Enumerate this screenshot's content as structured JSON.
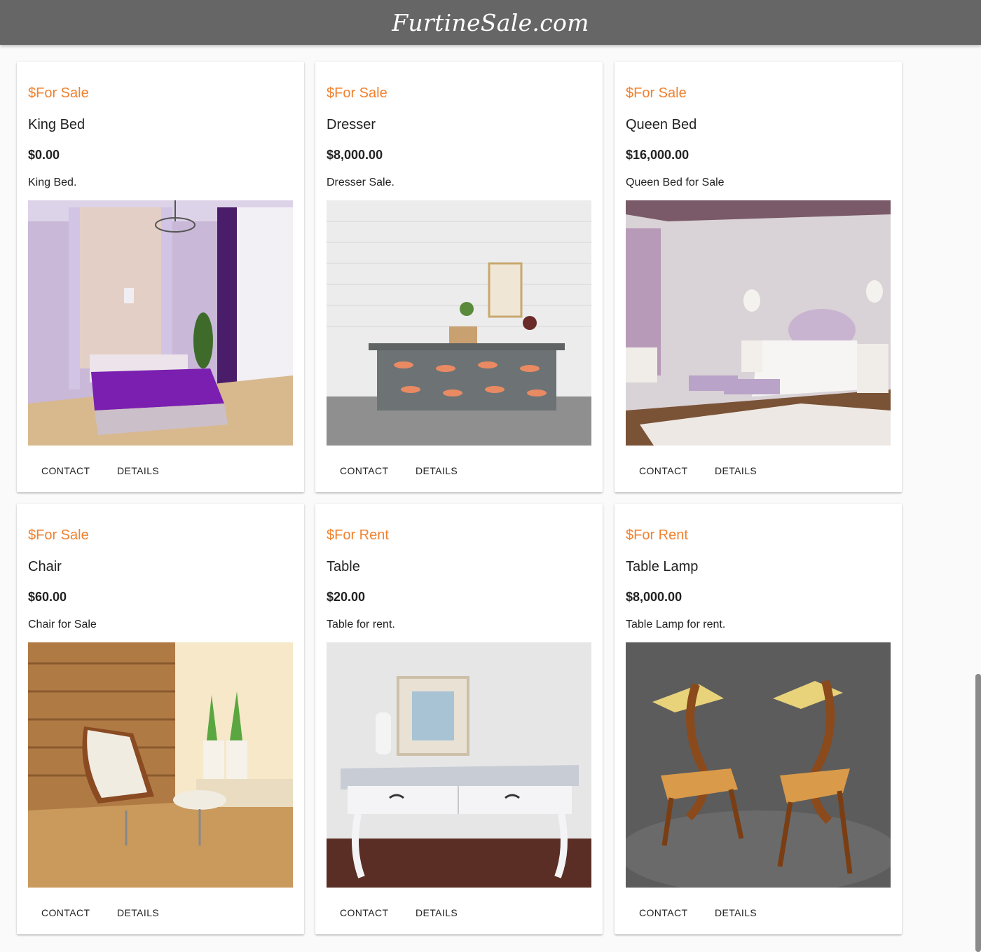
{
  "header": {
    "brand": "FurtineSale.com"
  },
  "cards": [
    {
      "status": "$For Sale",
      "title": "King Bed",
      "price": "$0.00",
      "description": "King Bed.",
      "image": "purple-bedroom-photo",
      "contact_label": "CONTACT",
      "details_label": "DETAILS"
    },
    {
      "status": "$For Sale",
      "title": "Dresser",
      "price": "$8,000.00",
      "description": "Dresser Sale.",
      "image": "gray-dresser-photo",
      "contact_label": "CONTACT",
      "details_label": "DETAILS"
    },
    {
      "status": "$For Sale",
      "title": "Queen Bed",
      "price": "$16,000.00",
      "description": "Queen Bed for Sale",
      "image": "lilac-bedroom-photo",
      "contact_label": "CONTACT",
      "details_label": "DETAILS"
    },
    {
      "status": "$For Sale",
      "title": "Chair",
      "price": "$60.00",
      "description": "Chair for Sale",
      "image": "lounge-chair-photo",
      "contact_label": "CONTACT",
      "details_label": "DETAILS"
    },
    {
      "status": "$For Rent",
      "title": "Table",
      "price": "$20.00",
      "description": "Table for rent.",
      "image": "white-console-table-photo",
      "contact_label": "CONTACT",
      "details_label": "DETAILS"
    },
    {
      "status": "$For Rent",
      "title": "Table Lamp",
      "price": "$8,000.00",
      "description": "Table Lamp for rent.",
      "image": "wooden-lamp-chairs-photo",
      "contact_label": "CONTACT",
      "details_label": "DETAILS"
    }
  ],
  "colors": {
    "accent": "#f0812f",
    "header_bg": "#666666",
    "page_bg": "#fafafa"
  }
}
